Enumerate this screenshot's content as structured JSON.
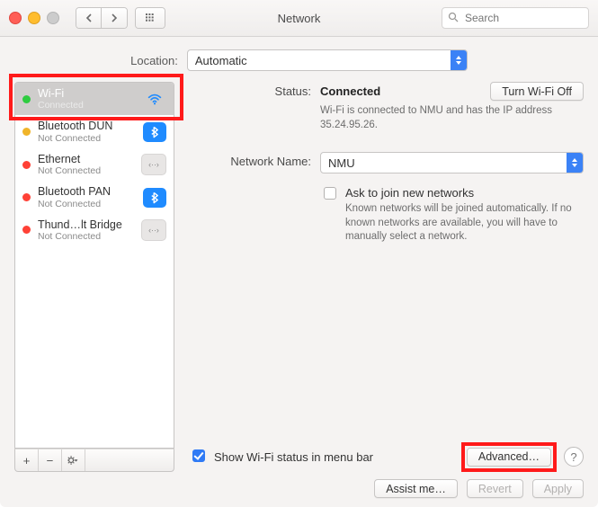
{
  "window": {
    "title": "Network"
  },
  "search": {
    "placeholder": "Search"
  },
  "location": {
    "label": "Location:",
    "value": "Automatic"
  },
  "sidebar": {
    "items": [
      {
        "name": "Wi-Fi",
        "sub": "Connected",
        "status": "green",
        "icon": "wifi",
        "selected": true
      },
      {
        "name": "Bluetooth DUN",
        "sub": "Not Connected",
        "status": "yellow",
        "icon": "bluetooth"
      },
      {
        "name": "Ethernet",
        "sub": "Not Connected",
        "status": "red",
        "icon": "ethernet"
      },
      {
        "name": "Bluetooth PAN",
        "sub": "Not Connected",
        "status": "red",
        "icon": "bluetooth"
      },
      {
        "name": "Thund…lt Bridge",
        "sub": "Not Connected",
        "status": "red",
        "icon": "ethernet"
      }
    ]
  },
  "status": {
    "label": "Status:",
    "value": "Connected",
    "toggle": "Turn Wi-Fi Off",
    "desc": "Wi-Fi is connected to NMU and has the IP address 35.24.95.26."
  },
  "network": {
    "label": "Network Name:",
    "value": "NMU",
    "askjoin_label": "Ask to join new networks",
    "askjoin_desc": "Known networks will be joined automatically. If no known networks are available, you will have to manually select a network."
  },
  "bottom": {
    "show_status": "Show Wi-Fi status in menu bar",
    "advanced": "Advanced…"
  },
  "footer": {
    "assist": "Assist me…",
    "revert": "Revert",
    "apply": "Apply"
  }
}
